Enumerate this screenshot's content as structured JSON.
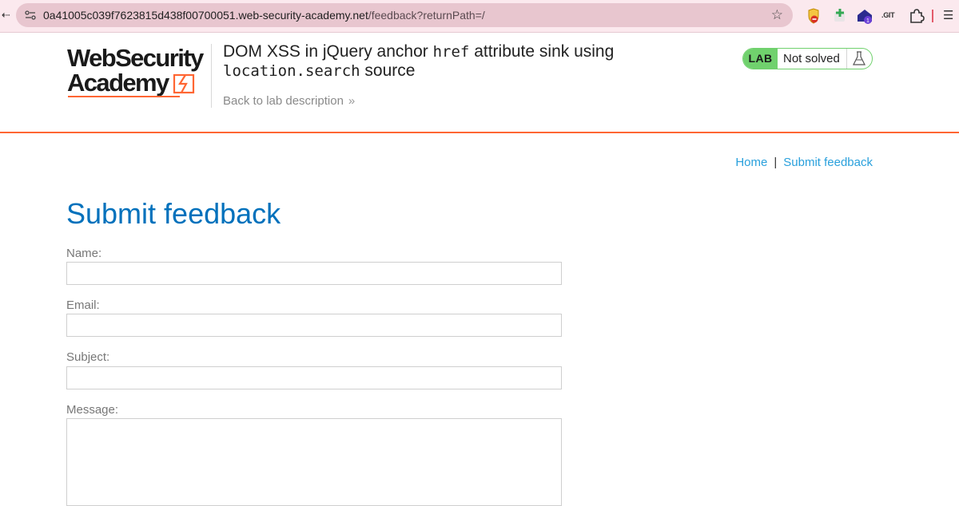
{
  "browser": {
    "url_host": "0a41005c039f7623815d438f00700051.web-security-academy.net",
    "url_path": "/feedback?returnPath=/",
    "extensions": [
      "extension-ublock-icon",
      "extension-puzzle-plus-icon",
      "extension-badge-icon",
      "extension-git-icon",
      "extensions-puzzle-icon",
      "reading-list-icon"
    ],
    "ext_badge_count": "1",
    "ext_git_label": ".GIT"
  },
  "header": {
    "logo_line1": "WebSecurity",
    "logo_line2": "Academy",
    "title_part1": "DOM XSS in jQuery anchor ",
    "title_code1": "href",
    "title_part2": " attribute sink using",
    "title_code2": "location.search",
    "title_part3": " source",
    "back_link": "Back to lab description",
    "lab_tag": "LAB",
    "lab_status": "Not solved"
  },
  "nav": {
    "home": "Home",
    "separator": "|",
    "submit_feedback": "Submit feedback"
  },
  "form": {
    "title": "Submit feedback",
    "name_label": "Name:",
    "email_label": "Email:",
    "subject_label": "Subject:",
    "message_label": "Message:",
    "name_value": "",
    "email_value": "",
    "subject_value": "",
    "message_value": ""
  },
  "colors": {
    "accent_orange": "#ff6633",
    "title_blue": "#0071bc",
    "link_blue": "#29a0dc",
    "lab_green": "#70d16d"
  }
}
